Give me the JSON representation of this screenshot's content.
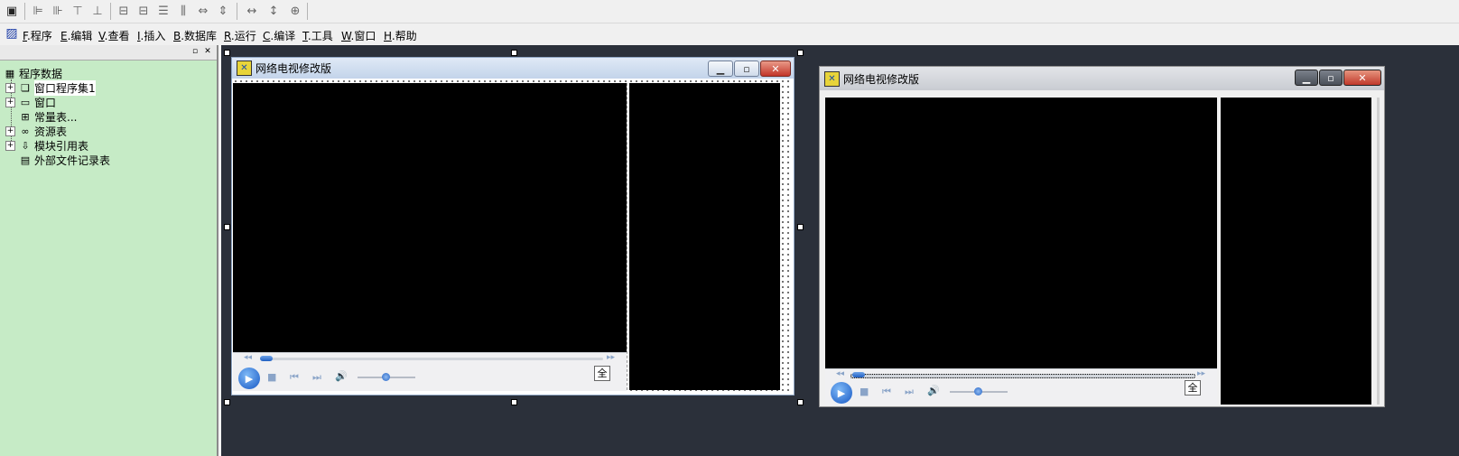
{
  "menubar": {
    "items": [
      {
        "key": "F",
        "label": ".程序"
      },
      {
        "key": "E",
        "label": ".编辑"
      },
      {
        "key": "V",
        "label": ".查看"
      },
      {
        "key": "I",
        "label": ".插入"
      },
      {
        "key": "B",
        "label": ".数据库"
      },
      {
        "key": "R",
        "label": ".运行"
      },
      {
        "key": "C",
        "label": ".编译"
      },
      {
        "key": "T",
        "label": ".工具"
      },
      {
        "key": "W",
        "label": ".窗口"
      },
      {
        "key": "H",
        "label": ".帮助"
      }
    ]
  },
  "tree": {
    "root": "程序数据",
    "items": [
      {
        "label": "窗口程序集1",
        "expandable": true,
        "icon": "assembly-icon"
      },
      {
        "label": "窗口",
        "expandable": true,
        "icon": "window-icon"
      },
      {
        "label": "常量表...",
        "expandable": false,
        "icon": "constant-table-icon"
      },
      {
        "label": "资源表",
        "expandable": true,
        "icon": "resource-table-icon"
      },
      {
        "label": "模块引用表",
        "expandable": true,
        "icon": "module-reference-icon"
      },
      {
        "label": "外部文件记录表",
        "expandable": false,
        "icon": "external-file-icon"
      }
    ]
  },
  "design_window": {
    "title": "网络电视修改版",
    "full_button": "全"
  },
  "run_window": {
    "title": "网络电视修改版",
    "full_button": "全"
  },
  "symbols": {
    "expand": "+",
    "minimize": "▁",
    "restore": "▫",
    "close": "✕",
    "play": "▶",
    "stop": "■",
    "prev": "⏮",
    "next": "⏭",
    "volume": "🔊",
    "rewind": "◂◂",
    "forward": "▸▸"
  },
  "colors": {
    "tree_background": "#c6ebc6",
    "workspace_background": "#2b303a"
  }
}
